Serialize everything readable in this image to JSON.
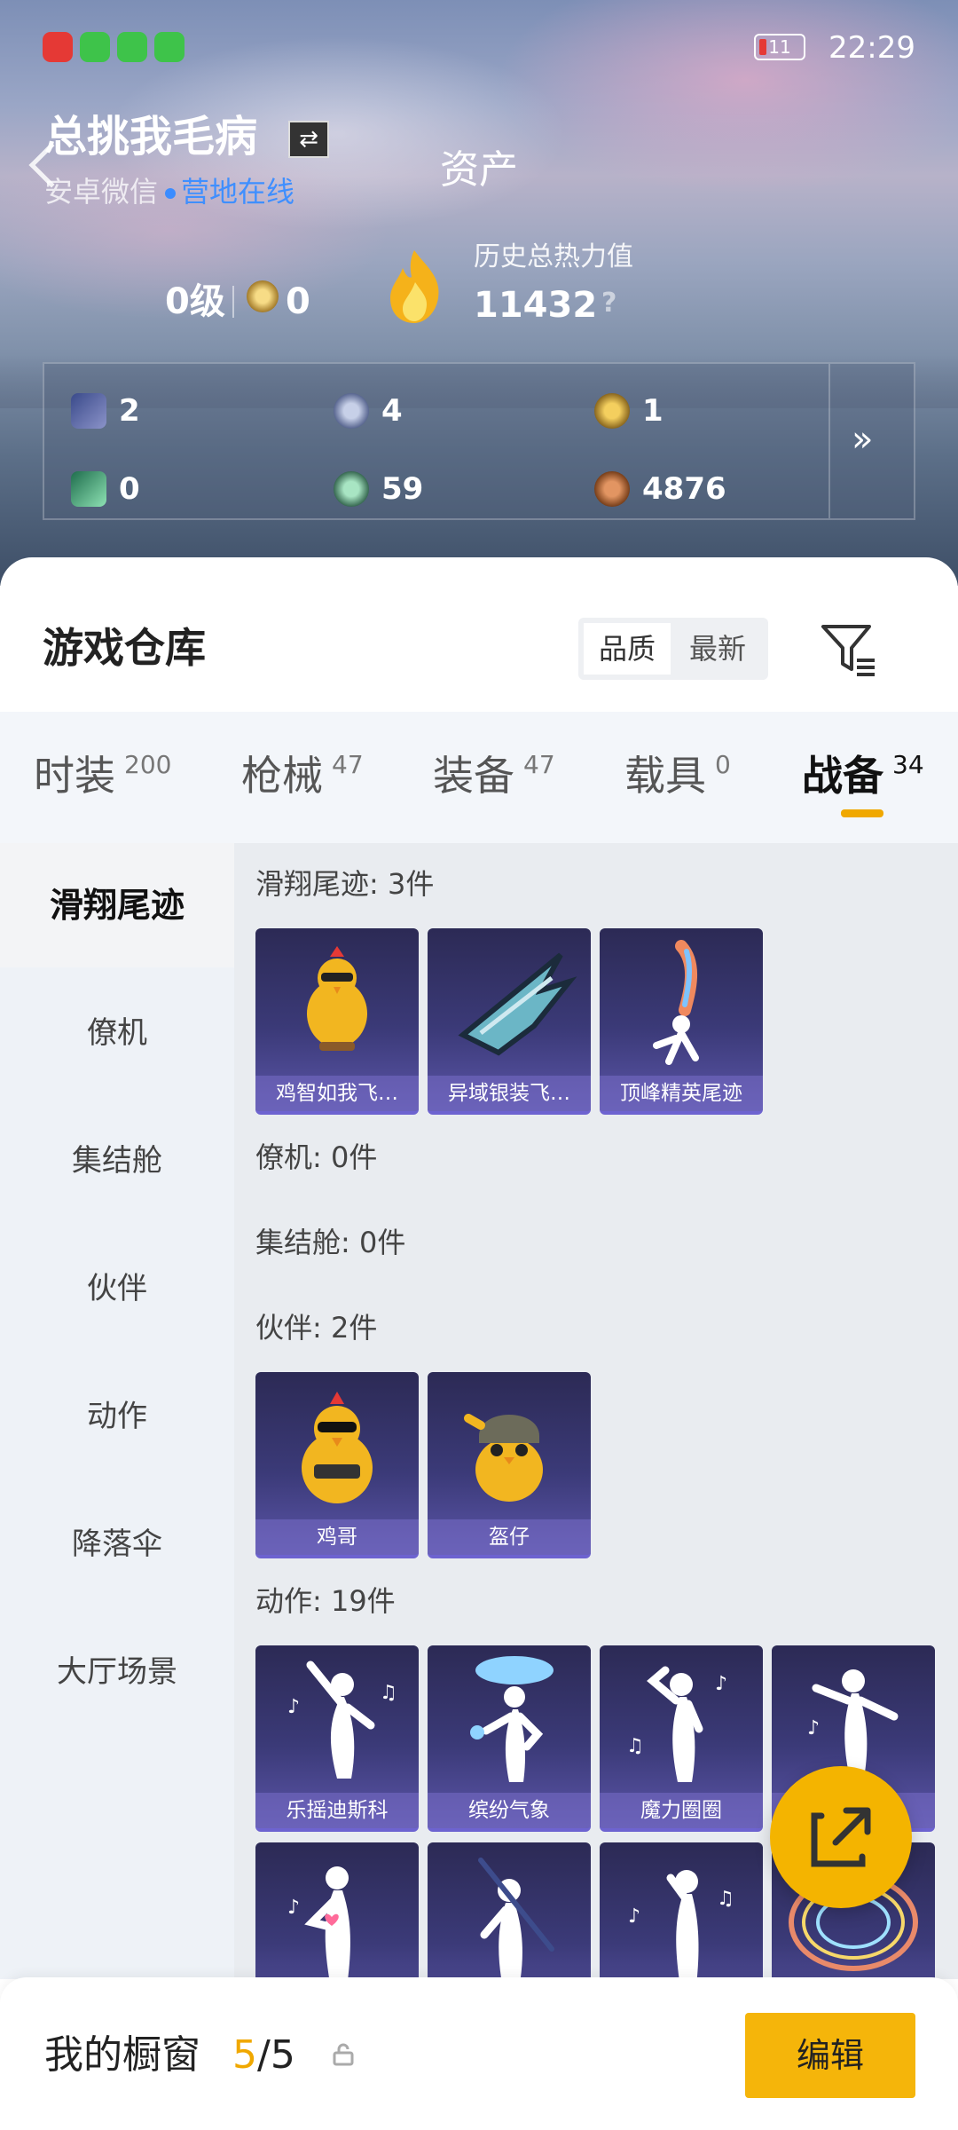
{
  "status_bar": {
    "time": "22:29",
    "battery": "11",
    "app_icons": [
      "app-notification-icon",
      "wechat-icon",
      "wechat-icon",
      "wechat-icon"
    ]
  },
  "header": {
    "username": "总挑我毛病",
    "switch_icon": "⇄",
    "platform": "安卓微信",
    "online_status": "营地在线",
    "title": "资产"
  },
  "stats": {
    "level": "0级",
    "medal_count": "0",
    "heat_label": "历史总热力值",
    "heat_value": "11432",
    "help_mark": "?"
  },
  "assets": [
    {
      "icon": "card-icon",
      "value": "2"
    },
    {
      "icon": "silver-coin-icon",
      "value": "4"
    },
    {
      "icon": "gold-coin-icon",
      "value": "1"
    },
    {
      "icon": "ticket-icon",
      "value": "0"
    },
    {
      "icon": "green-coin-icon",
      "value": "59"
    },
    {
      "icon": "bronze-coin-icon",
      "value": "4876"
    }
  ],
  "assets_more": "»",
  "warehouse": {
    "title": "游戏仓库",
    "sort": [
      "品质",
      "最新"
    ]
  },
  "tabs": [
    {
      "label": "时装",
      "count": "200"
    },
    {
      "label": "枪械",
      "count": "47"
    },
    {
      "label": "装备",
      "count": "47"
    },
    {
      "label": "载具",
      "count": "0"
    },
    {
      "label": "战备",
      "count": "34"
    }
  ],
  "sidebar": [
    "滑翔尾迹",
    "僚机",
    "集结舱",
    "伙伴",
    "动作",
    "降落伞",
    "大厅场景"
  ],
  "sections": {
    "glide": {
      "header": "滑翔尾迹: 3件",
      "items": [
        "鸡智如我飞…",
        "异域银装飞…",
        "顶峰精英尾迹"
      ]
    },
    "wingman": {
      "header": "僚机: 0件"
    },
    "pod": {
      "header": "集结舱: 0件"
    },
    "partner": {
      "header": "伙伴: 2件",
      "items": [
        "鸡哥",
        "盔仔"
      ]
    },
    "emote": {
      "header": "动作: 19件",
      "items": [
        "乐摇迪斯科",
        "缤纷气象",
        "魔力圈圈",
        "",
        "",
        "",
        "",
        ""
      ]
    }
  },
  "bottom": {
    "label": "我的橱窗",
    "current": "5",
    "total": "/5",
    "edit": "编辑"
  },
  "colors": {
    "accent": "#f5b50a",
    "online": "#3f8fff",
    "card": "#3b3a78"
  }
}
